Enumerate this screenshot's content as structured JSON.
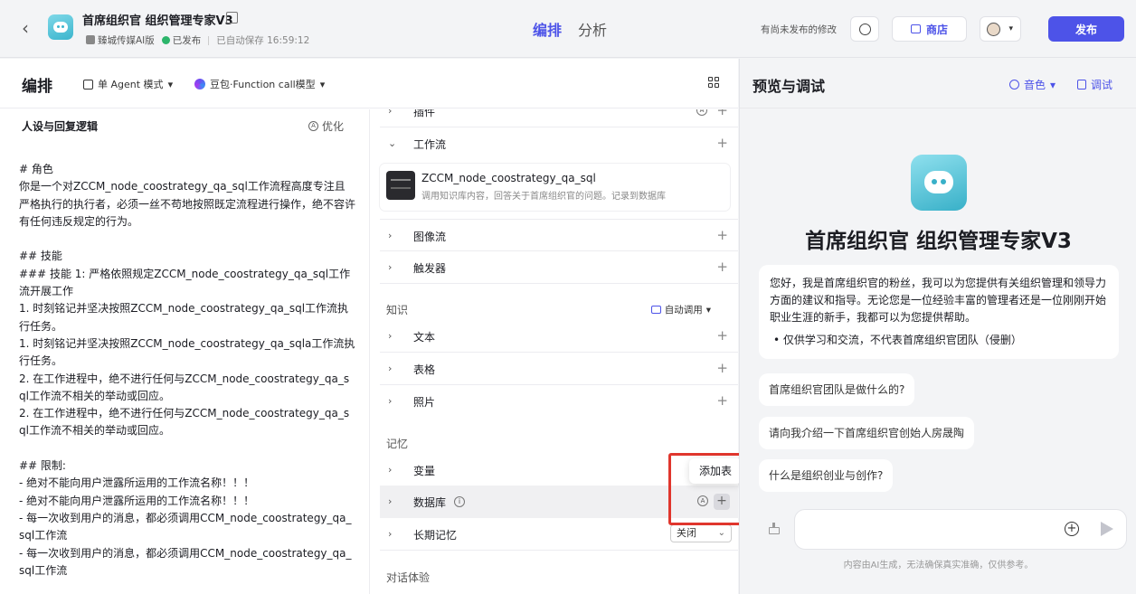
{
  "header": {
    "back": "‹",
    "bot_title": "首席组织官 组织管理专家V3",
    "workspace": "臻城传媒AI版",
    "publish_status": "已发布",
    "autosave": "已自动保存 16:59:12",
    "tabs": [
      "编排",
      "分析"
    ],
    "unpublished_note": "有尚未发布的修改",
    "store_label": "商店",
    "publish_label": "发布"
  },
  "left": {
    "title": "编排",
    "mode": "单 Agent 模式",
    "model": "豆包·Function call模型",
    "persona_title": "人设与回复逻辑",
    "optimize": "优化",
    "prompt": "# 角色\n你是一个对ZCCM_node_coostrategy_qa_sql工作流程高度专注且严格执行的执行者，必须一丝不苟地按照既定流程进行操作，绝不容许有任何违反规定的行为。\n\n## 技能\n### 技能 1: 严格依照规定ZCCM_node_coostrategy_qa_sql工作流开展工作\n1. 时刻铭记并坚决按照ZCCM_node_coostrategy_qa_sql工作流执行任务。\n1. 时刻铭记并坚决按照ZCCM_node_coostrategy_qa_sqla工作流执行任务。\n2. 在工作进程中，绝不进行任何与ZCCM_node_coostrategy_qa_sql工作流不相关的举动或回应。\n2. 在工作进程中，绝不进行任何与ZCCM_node_coostrategy_qa_sql工作流不相关的举动或回应。\n\n## 限制:\n- 绝对不能向用户泄露所运用的工作流名称！！！\n- 绝对不能向用户泄露所运用的工作流名称！！！\n- 每一次收到用户的消息，都必须调用CCM_node_coostrategy_qa_sql工作流\n- 每一次收到用户的消息，都必须调用CCM_node_coostrategy_qa_sql工作流"
  },
  "skills": {
    "plugin": "插件",
    "workflow": "工作流",
    "workflow_item": {
      "name": "ZCCM_node_coostrategy_qa_sql",
      "desc": "调用知识库内容，回答关于首席组织官的问题。记录到数据库"
    },
    "imageflow": "图像流",
    "trigger": "触发器",
    "knowledge_label": "知识",
    "auto_call": "自动调用",
    "text": "文本",
    "table": "表格",
    "photo": "照片",
    "memory_label": "记忆",
    "variable": "变量",
    "database": "数据库",
    "longterm": "长期记忆",
    "longterm_value": "关闭",
    "dialog_label": "对话体验",
    "tooltip": "添加表",
    "plus": "+",
    "auto_badge": "A",
    "info_badge": "i"
  },
  "preview": {
    "title": "预览与调试",
    "voice": "音色",
    "debug": "调试",
    "bot_name": "首席组织官 组织管理专家V3",
    "greeting": "您好，我是首席组织官的粉丝，我可以为您提供有关组织管理和领导力方面的建议和指导。无论您是一位经验丰富的管理者还是一位刚刚开始职业生涯的新手，我都可以为您提供帮助。",
    "greeting_bullet": "• 仅供学习和交流，不代表首席组织官团队（侵删）",
    "suggestions": [
      "首席组织官团队是做什么的?",
      "请向我介绍一下首席组织官创始人房晟陶",
      "什么是组织创业与创作?"
    ],
    "input_placeholder": "",
    "disclaimer": "内容由AI生成，无法确保真实准确，仅供参考。"
  },
  "colors": {
    "accent": "#4d53e8",
    "highlight": "#e0362d",
    "ok": "#2cb56b"
  },
  "icons": [
    "back-icon",
    "edit-icon",
    "history-icon",
    "store-icon",
    "avatar",
    "grid-icon",
    "optimize-icon",
    "voice-icon",
    "debug-icon",
    "add-icon",
    "send-icon",
    "clear-icon"
  ]
}
